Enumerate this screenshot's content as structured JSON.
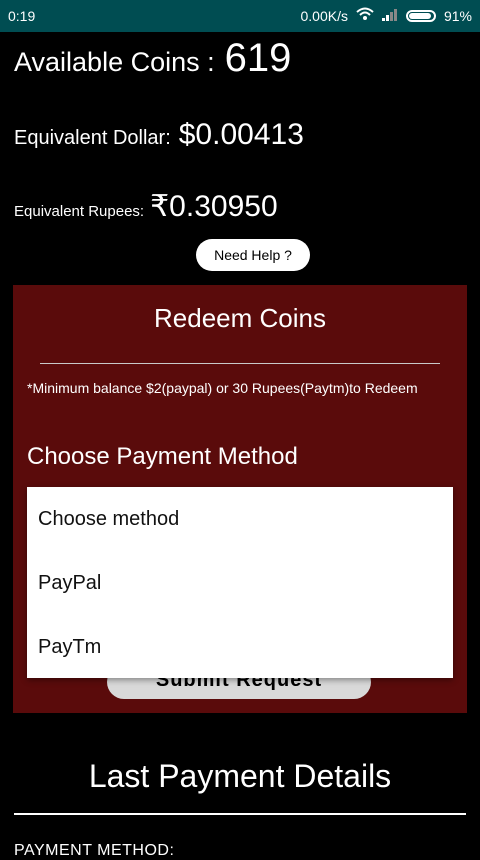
{
  "status_bar": {
    "time": "0:19",
    "network_speed": "0.00K/s",
    "battery": "91%"
  },
  "balance": {
    "coins_label": "Available Coins :",
    "coins_value": "619",
    "dollar_label": "Equivalent Dollar:",
    "dollar_value": "$0.00413",
    "rupee_label": "Equivalent Rupees:",
    "rupee_value": "₹0.30950"
  },
  "help_button": "Need Help ?",
  "redeem": {
    "title": "Redeem Coins",
    "note": "*Minimum balance $2(paypal) or 30 Rupees(Paytm)to Redeem",
    "choose_label": "Choose Payment Method",
    "submit_label": "Submit Request"
  },
  "dropdown": {
    "options": [
      "Choose method",
      "PayPal",
      "PayTm"
    ]
  },
  "last_payment": {
    "title": "Last Payment Details",
    "method_label": "PAYMENT METHOD:"
  },
  "colors": {
    "status_bar": "#004d52",
    "card": "#5a0b0b",
    "background": "#000000"
  }
}
